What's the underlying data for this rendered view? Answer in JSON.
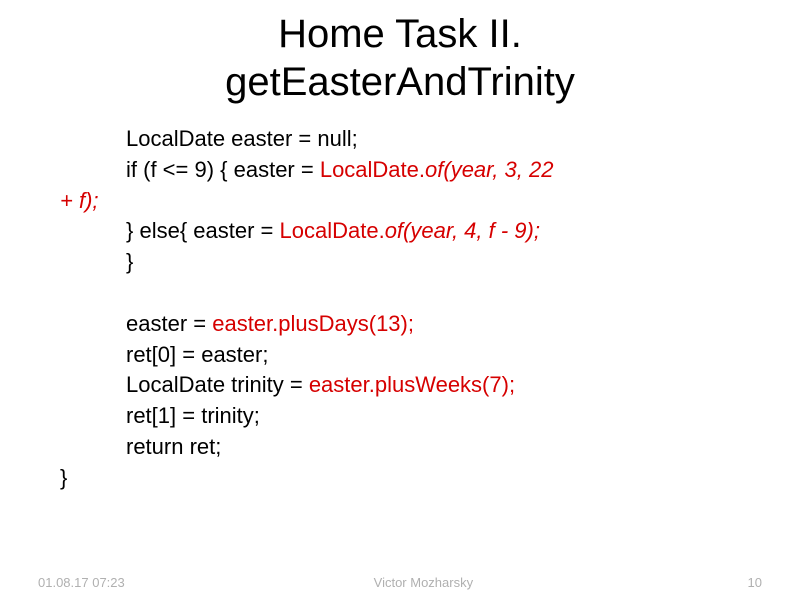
{
  "title": {
    "line1": "Home Task II.",
    "line2": "getEasterAndTrinity"
  },
  "code": {
    "l1_a": "LocalDate easter = null;",
    "l2_a": "if (f <= 9) { easter = ",
    "l2_b": "LocalDate.",
    "l2_c": "of(year, 3, 22 ",
    "l2_wrap": "+ f);",
    "l3_a": "} else{ easter = ",
    "l3_b": "LocalDate.",
    "l3_c": "of(year, 4, f - 9);",
    "l4": "}",
    "l6_a": "easter = ",
    "l6_b": "easter.plusDays(13);",
    "l7": "ret[0] = easter;",
    "l8_a": "LocalDate trinity = ",
    "l8_b": "easter.plusWeeks(7);",
    "l9": "ret[1] = trinity;",
    "l10": "return ret;",
    "l11": "}"
  },
  "footer": {
    "date": "01.08.17 07:23",
    "author": "Victor Mozharsky",
    "page": "10"
  }
}
